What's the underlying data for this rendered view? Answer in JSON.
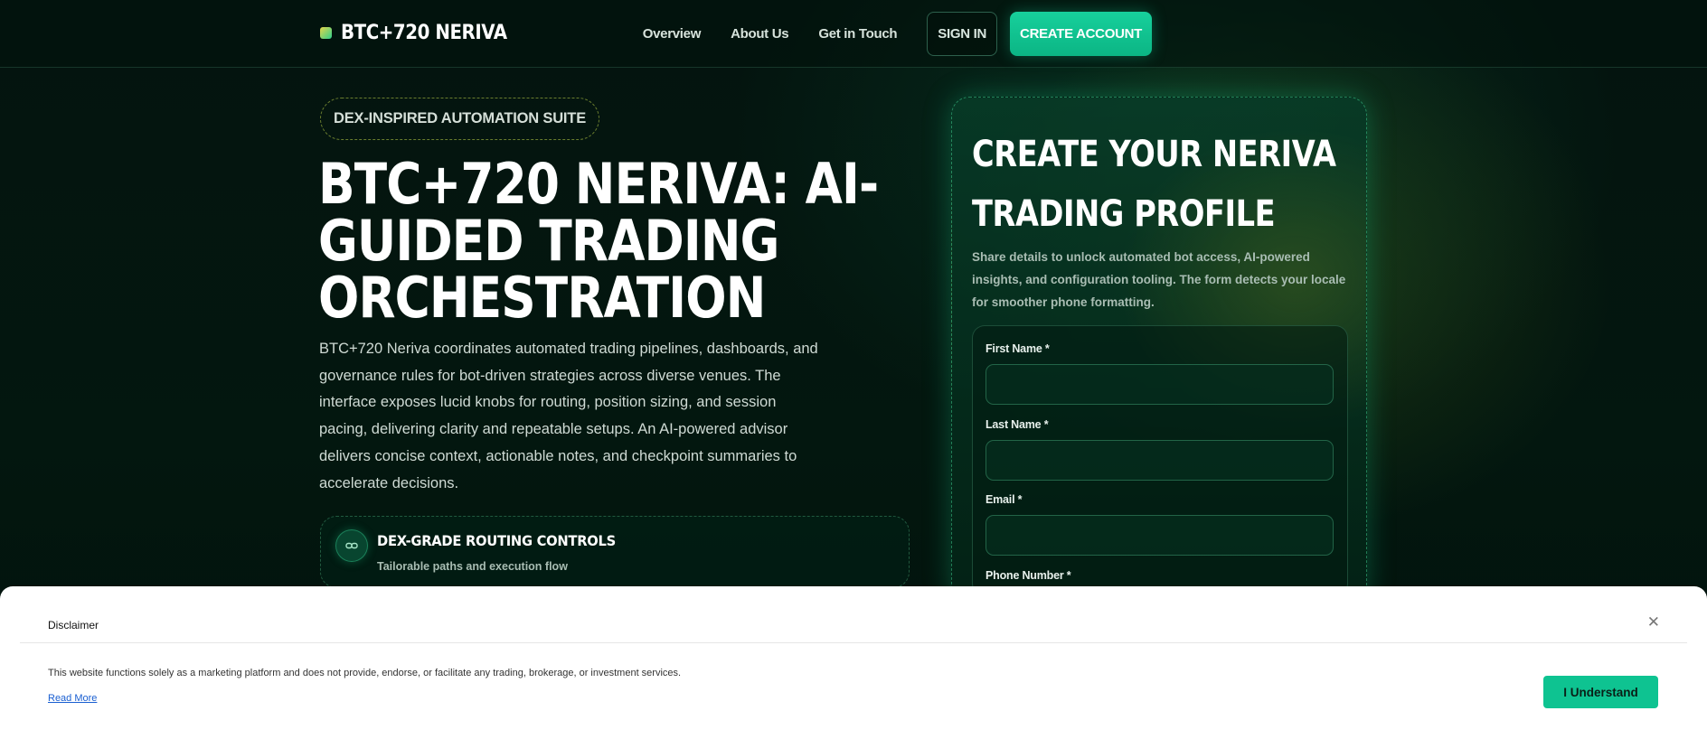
{
  "header": {
    "logo_text": "BTC+720 NERIVA",
    "nav": [
      "Overview",
      "About Us",
      "Get in Touch"
    ],
    "sign_in": "SIGN IN",
    "create_account": "CREATE ACCOUNT"
  },
  "hero": {
    "pill": "DEX-INSPIRED AUTOMATION SUITE",
    "title_lines": [
      "BTC+720 NERIVA: AI-",
      "GUIDED TRADING",
      "ORCHESTRATION"
    ],
    "description": "BTC+720 Neriva coordinates automated trading pipelines, dashboards, and governance rules for bot-driven strategies across diverse venues. The interface exposes lucid knobs for routing, position sizing, and session pacing, delivering clarity and repeatable setups. An AI-powered advisor delivers concise context, actionable notes, and checkpoint summaries to accelerate decisions.",
    "feature": {
      "icon": "link-icon",
      "title": "DEX-GRADE ROUTING CONTROLS",
      "subtitle": "Tailorable paths and execution flow"
    }
  },
  "form": {
    "title_lines": [
      "CREATE YOUR NERIVA",
      "TRADING PROFILE"
    ],
    "description": "Share details to unlock automated bot access, AI-powered insights, and configuration tooling. The form detects your locale for smoother phone formatting.",
    "first_name_label": "First Name *",
    "first_name_value": "",
    "last_name_label": "Last Name *",
    "last_name_value": "",
    "email_label": "Email *",
    "email_value": "",
    "phone_label": "Phone Number *"
  },
  "disclaimer": {
    "title": "Disclaimer",
    "text": "This website functions solely as a marketing platform and does not provide, endorse, or facilitate any trading, brokerage, or investment services.",
    "read_more": "Read More",
    "button": "I Understand",
    "close_icon": "close-icon"
  },
  "colors": {
    "accent": "#0ec391",
    "background": "#03170f",
    "link": "#1a5fd1"
  }
}
